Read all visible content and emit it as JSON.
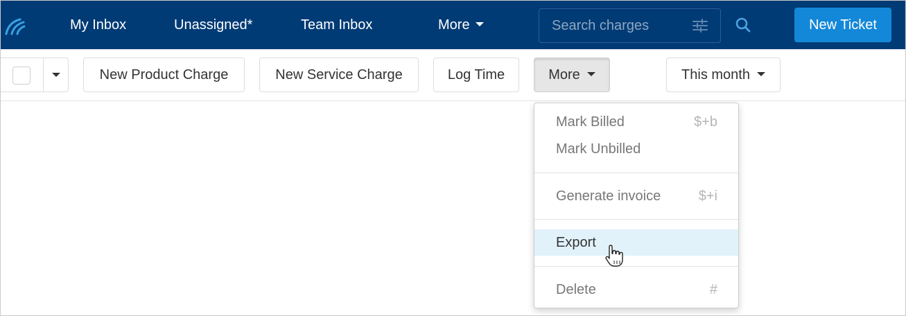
{
  "nav": {
    "items": [
      {
        "label": "My Inbox"
      },
      {
        "label": "Unassigned*"
      },
      {
        "label": "Team Inbox"
      },
      {
        "label": "More"
      }
    ],
    "search_placeholder": "Search charges",
    "new_ticket_label": "New Ticket",
    "icons": {
      "logo": "app-logo-icon",
      "filter": "sliders-icon",
      "search": "search-icon"
    }
  },
  "toolbar": {
    "new_product_charge": "New Product Charge",
    "new_service_charge": "New Service Charge",
    "log_time": "Log Time",
    "more": "More",
    "date_filter": "This month"
  },
  "dropdown": {
    "items": [
      {
        "label": "Mark Billed",
        "shortcut": "$+b"
      },
      {
        "label": "Mark Unbilled",
        "shortcut": ""
      },
      {
        "label": "Generate invoice",
        "shortcut": "$+i"
      },
      {
        "label": "Export",
        "shortcut": ""
      },
      {
        "label": "Delete",
        "shortcut": "#"
      }
    ],
    "hovered_label": "Export"
  },
  "colors": {
    "navbar": "#003b75",
    "primary_button": "#1488d8",
    "menu_hover": "#e1f2fb"
  }
}
